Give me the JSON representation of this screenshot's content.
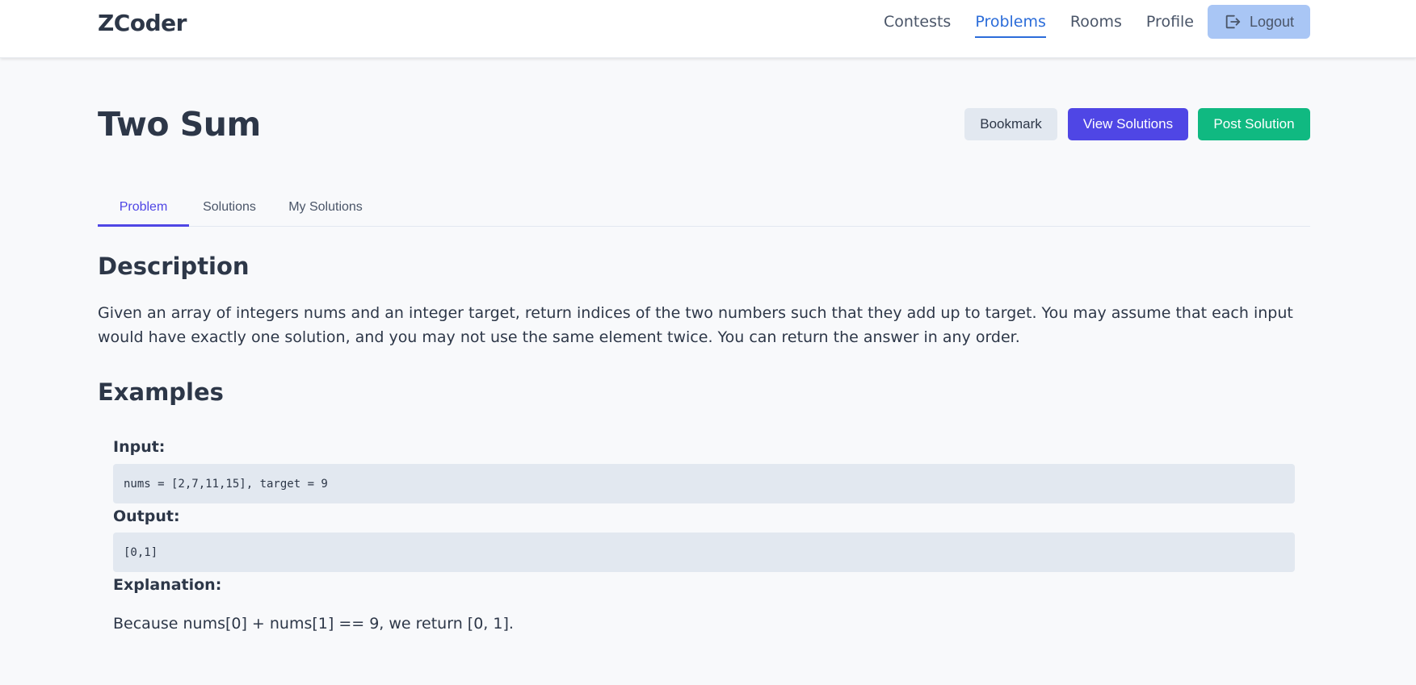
{
  "brand": "ZCoder",
  "nav": {
    "links": [
      "Contests",
      "Problems",
      "Rooms",
      "Profile"
    ],
    "active": "Problems",
    "logout_label": "Logout"
  },
  "problem": {
    "title": "Two Sum",
    "actions": {
      "bookmark": "Bookmark",
      "view_solutions": "View Solutions",
      "post_solution": "Post Solution"
    },
    "tabs": [
      "Problem",
      "Solutions",
      "My Solutions"
    ],
    "active_tab": "Problem",
    "description_heading": "Description",
    "description": "Given an array of integers nums and an integer target, return indices of the two numbers such that they add up to target. You may assume that each input would have exactly one solution, and you may not use the same element twice. You can return the answer in any order.",
    "examples_heading": "Examples",
    "example": {
      "input_label": "Input:",
      "input": "nums = [2,7,11,15], target = 9",
      "output_label": "Output:",
      "output": "[0,1]",
      "explanation_label": "Explanation:",
      "explanation": "Because nums[0] + nums[1] == 9, we return [0, 1]."
    }
  },
  "colors": {
    "primary": "#4f46e5",
    "success": "#10b981",
    "nav_active": "#2b6cd9",
    "logout_bg": "#a9c6f5"
  },
  "icons": {
    "logout": "logout-icon"
  }
}
